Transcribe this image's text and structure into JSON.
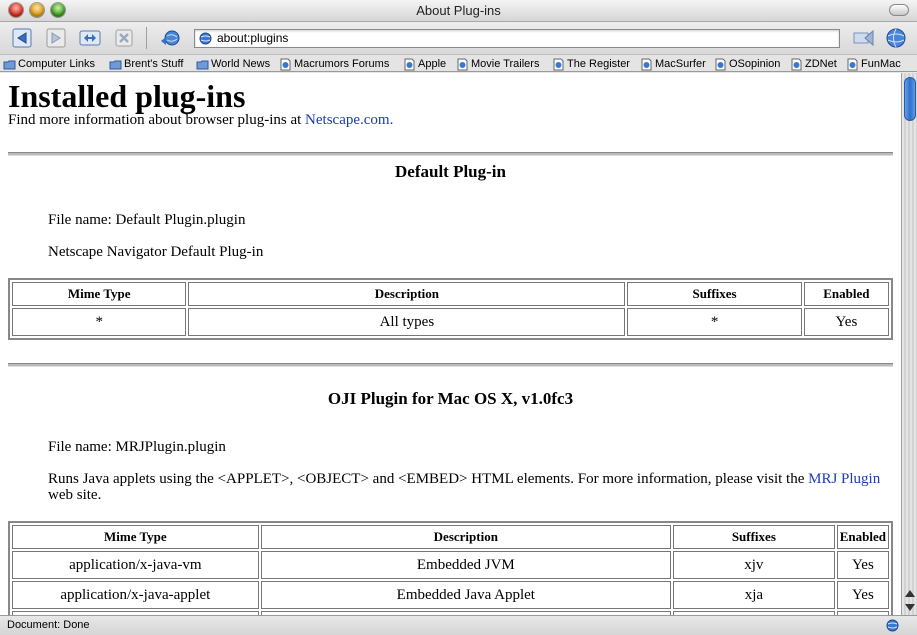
{
  "window": {
    "title": "About Plug-ins"
  },
  "toolbar": {
    "url": "about:plugins"
  },
  "bookmarks": [
    {
      "label": "Computer Links",
      "icon": "folder-icon"
    },
    {
      "label": "Brent's Stuff",
      "icon": "folder-icon"
    },
    {
      "label": "World News",
      "icon": "folder-icon"
    },
    {
      "label": "Macrumors Forums",
      "icon": "page-icon"
    },
    {
      "label": "Apple",
      "icon": "page-icon"
    },
    {
      "label": "Movie Trailers",
      "icon": "page-icon"
    },
    {
      "label": "The Register",
      "icon": "page-icon"
    },
    {
      "label": "MacSurfer",
      "icon": "page-icon"
    },
    {
      "label": "OSopinion",
      "icon": "page-icon"
    },
    {
      "label": "ZDNet",
      "icon": "page-icon"
    },
    {
      "label": "FunMac",
      "icon": "page-icon"
    }
  ],
  "page": {
    "heading": "Installed plug-ins",
    "intro_text": "Find more information about browser plug-ins at ",
    "intro_link": "Netscape.com.",
    "plugins": [
      {
        "name": "Default Plug-in",
        "file_name": "File name: Default Plugin.plugin",
        "description": "Netscape Navigator Default Plug-in",
        "headers": [
          "Mime Type",
          "Description",
          "Suffixes",
          "Enabled"
        ],
        "rows": [
          [
            "*",
            "All types",
            "*",
            "Yes"
          ]
        ]
      },
      {
        "name": "OJI Plugin for Mac OS X, v1.0fc3",
        "file_name": "File name: MRJPlugin.plugin",
        "description": "Runs Java applets using the <APPLET>, <OBJECT> and <EMBED> HTML elements. For more information, please visit the ",
        "description_link": "MRJ Plugin",
        "description_tail": " web site.",
        "headers": [
          "Mime Type",
          "Description",
          "Suffixes",
          "Enabled"
        ],
        "rows": [
          [
            "application/x-java-vm",
            "Embedded JVM",
            "xjv",
            "Yes"
          ],
          [
            "application/x-java-applet",
            "Embedded Java Applet",
            "xja",
            "Yes"
          ]
        ]
      }
    ]
  },
  "status": {
    "text": "Document: Done"
  }
}
